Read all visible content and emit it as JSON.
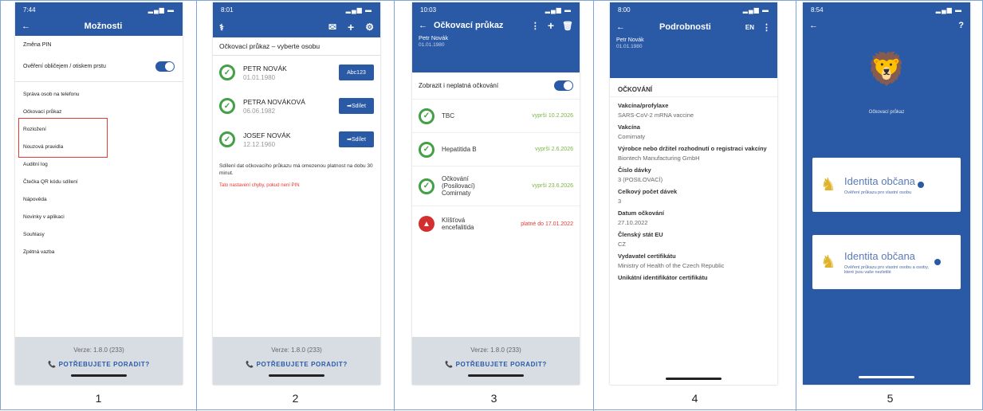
{
  "labels": [
    "1",
    "2",
    "3",
    "4",
    "5"
  ],
  "footer": {
    "version": "Verze: 1.8.0 (233)",
    "help": "POTŘEBUJETE PORADIT?"
  },
  "s1": {
    "time": "7:44",
    "title": "Možnosti",
    "items": [
      "Změna PIN",
      "Ověření obličejem / otiskem prstu",
      "Správa osob na telefonu",
      "Očkovací průkaz",
      "Rozložení",
      "Nouzová pravidla",
      "Auditní log",
      "Čtečka QR kódu sdílení",
      "Nápověda",
      "Novinky v aplikaci",
      "Souhlasy",
      "Zpětná vazba"
    ]
  },
  "s2": {
    "time": "8:01",
    "title": "Očkovací průkaz – vyberte osobu",
    "people": [
      {
        "name": "PETR NOVÁK",
        "date": "01.01.1980",
        "btn": "Abc123"
      },
      {
        "name": "PETRA NOVÁKOVÁ",
        "date": "06.06.1982",
        "btn": "Sdílet"
      },
      {
        "name": "JOSEF NOVÁK",
        "date": "12.12.1960",
        "btn": "Sdílet"
      }
    ],
    "note": "Sdílení dat očkovacího průkazu má omezenou platnost na dobu 30 minut.",
    "redlink": "Tato nastavení chyby, pokud není PIN"
  },
  "s3": {
    "time": "10:03",
    "title": "Očkovací průkaz",
    "name": "Petr Novák",
    "date": "01.01.1980",
    "toggle": "Zobrazit i neplatná očkování",
    "vaccines": [
      {
        "name": "TBC",
        "valid": "vyprší 10.2.2026"
      },
      {
        "name": "Hepatitida B",
        "valid": "vyprší 2.6.2026"
      },
      {
        "name": "Očkování (Posilovací) Comirnaty",
        "valid": "vyprší 23.6.2026"
      },
      {
        "name": "Klíšťová encefalitida",
        "valid": "platné do 17.01.2022"
      }
    ]
  },
  "s4": {
    "time": "8:00",
    "title": "Podrobnosti",
    "lang": "EN",
    "name": "Petr Novák",
    "date": "01.01.1980",
    "section": "OČKOVÁNÍ",
    "rows": [
      {
        "label": "Vakcína/profylaxe",
        "value": "SARS-CoV-2 mRNA vaccine"
      },
      {
        "label": "Vakcína",
        "value": "Comirnaty"
      },
      {
        "label": "Výrobce nebo držitel rozhodnutí o registraci vakcíny",
        "value": "Biontech Manufacturing GmbH"
      },
      {
        "label": "Číslo dávky",
        "value": "3 (POSILOVACÍ)"
      },
      {
        "label": "Celkový počet dávek",
        "value": "3"
      },
      {
        "label": "Datum očkování",
        "value": "27.10.2022"
      },
      {
        "label": "Členský stát EU",
        "value": "CZ"
      },
      {
        "label": "Vydavatel certifikátu",
        "value": "Ministry of Health of the Czech Republic"
      },
      {
        "label": "Unikátní identifikátor certifikátu",
        "value": ""
      }
    ]
  },
  "s5": {
    "time": "8:54",
    "caption": "Očkovací průkaz",
    "card1_title": "Identita občana",
    "card1_sub": "Ověření průkazu pro vlastní osobu",
    "card2_title": "Identita občana",
    "card2_sub": "Ověření průkazu pro vlastní osobu a osoby, které jsou vaše nezletilé"
  }
}
